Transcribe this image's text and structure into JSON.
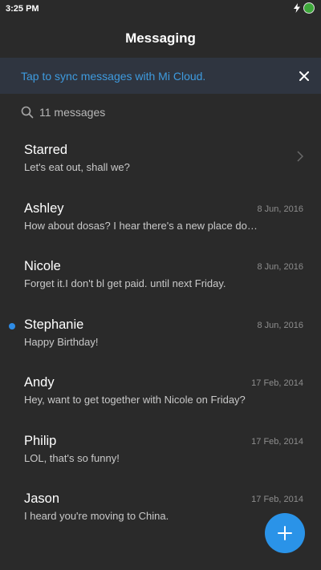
{
  "status_bar": {
    "time": "3:25 PM",
    "icons": [
      "charging-bolt-icon",
      "battery-indicator-icon"
    ]
  },
  "header": {
    "title": "Messaging"
  },
  "sync_banner": {
    "text": "Tap to sync messages with Mi Cloud.",
    "close_icon": "close-icon",
    "text_color": "#3e9bdf"
  },
  "search": {
    "icon": "search-icon",
    "label": "11 messages"
  },
  "conversations": [
    {
      "name": "Starred",
      "preview": "Let's eat out, shall we?",
      "date": "",
      "unread": false,
      "trailing_icon": "chevron-right-icon"
    },
    {
      "name": "Ashley",
      "preview": "How about dosas? I hear there's a new place do…",
      "date": "8 Jun, 2016",
      "unread": false
    },
    {
      "name": "Nicole",
      "preview": "Forget it.I don't bl get paid. until next Friday.",
      "date": "8 Jun, 2016",
      "unread": false
    },
    {
      "name": "Stephanie",
      "preview": "Happy Birthday!",
      "date": "8 Jun, 2016",
      "unread": true
    },
    {
      "name": "Andy",
      "preview": "Hey, want to get together with Nicole on Friday?",
      "date": "17 Feb, 2014",
      "unread": false
    },
    {
      "name": "Philip",
      "preview": "LOL, that's so funny!",
      "date": "17 Feb, 2014",
      "unread": false
    },
    {
      "name": "Jason",
      "preview": "I heard you're moving to China.",
      "date": "17 Feb, 2014",
      "unread": false
    }
  ],
  "fab": {
    "icon": "plus-icon",
    "color": "#2a93e8"
  },
  "colors": {
    "background": "#2a2a2a",
    "banner_background": "#2f3540",
    "unread_dot": "#2e8ce6"
  }
}
